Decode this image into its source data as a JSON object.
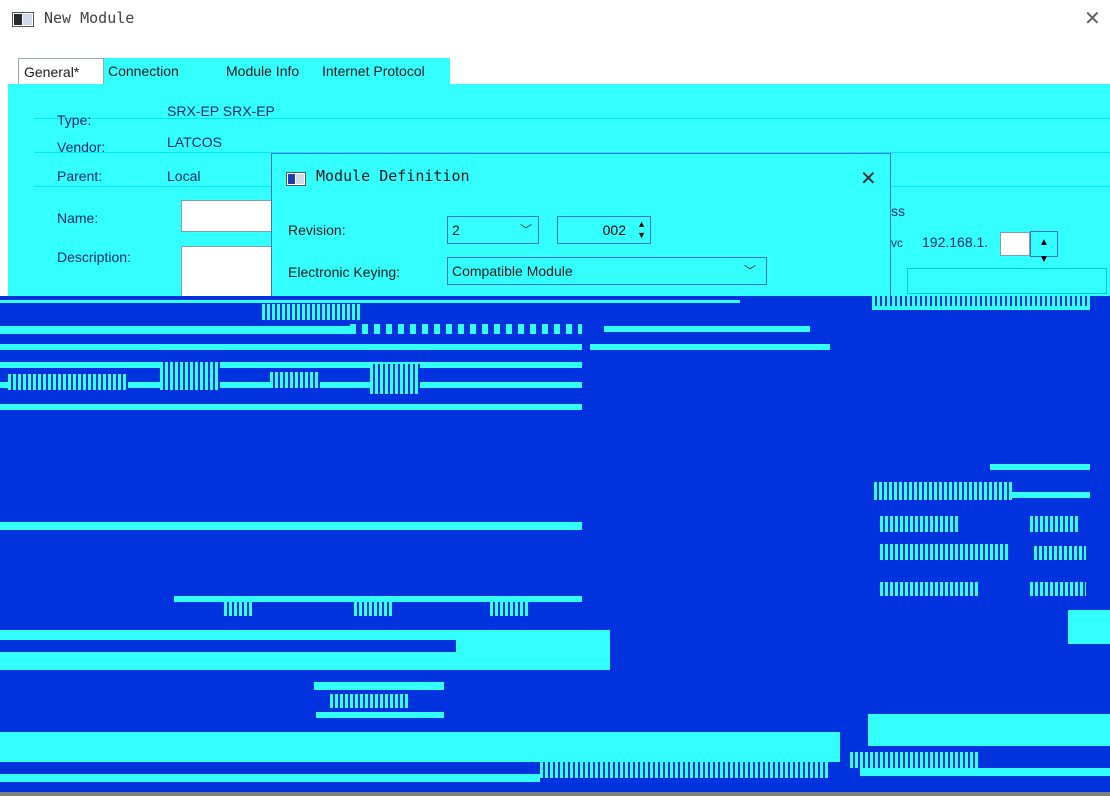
{
  "window": {
    "title": "New Module"
  },
  "tabs": [
    {
      "label": "General*"
    },
    {
      "label": "Connection"
    },
    {
      "label": "Module Info"
    },
    {
      "label": "Internet Protocol"
    }
  ],
  "general": {
    "type_label": "Type:",
    "type_value": "SRX-EP SRX-EP",
    "vendor_label": "Vendor:",
    "vendor_value": "LATCOS",
    "parent_label": "Parent:",
    "parent_value": "Local",
    "name_label": "Name:",
    "name_value": "",
    "description_label": "Description:",
    "description_value": ""
  },
  "address": {
    "group_label": "ss",
    "prefix_label": "vc",
    "ip_value": "192.168.1."
  },
  "dialog": {
    "title": "Module Definition",
    "revision_label": "Revision:",
    "revision_major": "2",
    "revision_minor": "002",
    "keying_label": "Electronic Keying:",
    "keying_value": "Compatible Module"
  },
  "colors": {
    "cyan": "#33ffff",
    "blue": "#0033dd",
    "accent": "#3d6fd6"
  }
}
